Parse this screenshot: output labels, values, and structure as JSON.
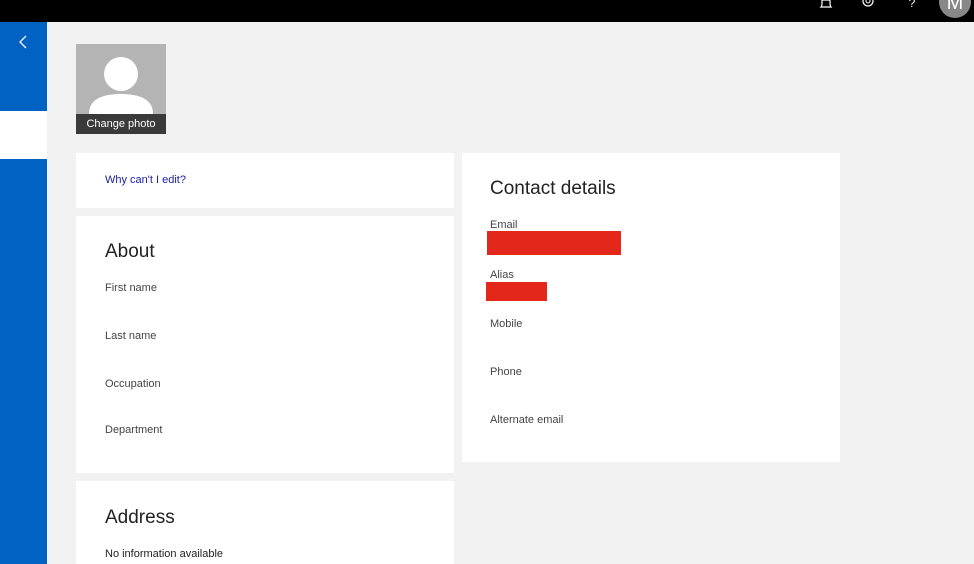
{
  "topbar": {
    "bell_icon": "bell-icon",
    "gear_icon": "gear-icon",
    "help_label": "?",
    "avatar_initial": "M"
  },
  "nav": {
    "back_icon": "chevron-left-icon"
  },
  "photo": {
    "change_label": "Change photo"
  },
  "why_edit": {
    "link_label": "Why can't I edit?"
  },
  "about": {
    "title": "About",
    "fields": [
      {
        "label": "First name"
      },
      {
        "label": "Last name"
      },
      {
        "label": "Occupation"
      },
      {
        "label": "Department"
      }
    ]
  },
  "address": {
    "title": "Address",
    "info": "No information available"
  },
  "contact": {
    "title": "Contact details",
    "fields": [
      {
        "label": "Email"
      },
      {
        "label": "Alias"
      },
      {
        "label": "Mobile"
      },
      {
        "label": "Phone"
      },
      {
        "label": "Alternate email"
      }
    ]
  },
  "colors": {
    "accent": "#0062c3",
    "redaction": "#e3271b",
    "link": "#1a1aa6"
  }
}
